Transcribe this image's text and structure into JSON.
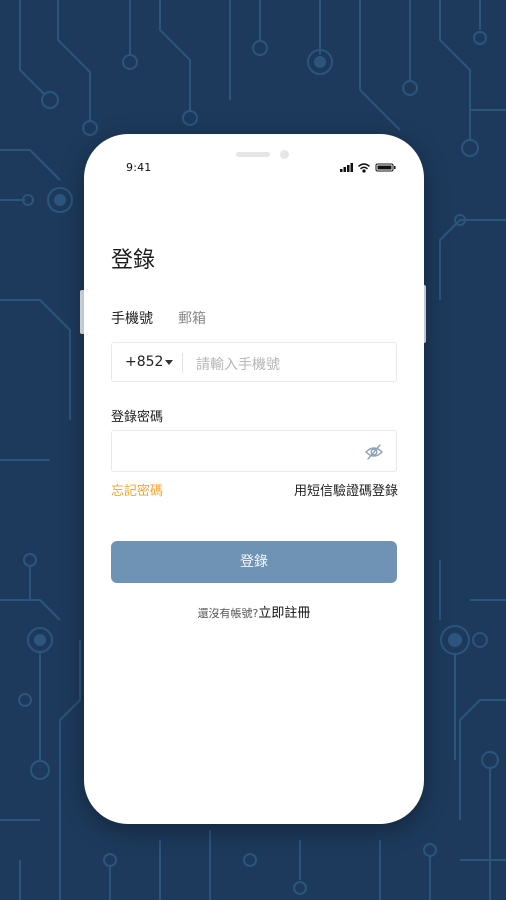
{
  "status_bar": {
    "time": "9:41"
  },
  "login": {
    "title": "登錄",
    "tabs": [
      {
        "label": "手機號"
      },
      {
        "label": "郵箱"
      }
    ],
    "country_code": "+852",
    "phone_placeholder": "請輸入手機號",
    "password_label": "登錄密碼",
    "forgot_password": "忘記密碼",
    "sms_login": "用短信驗證碼登錄",
    "submit": "登錄",
    "no_account": "還沒有帳號?",
    "register": "立即註冊"
  },
  "colors": {
    "background": "#1d3a5c",
    "accent_orange": "#f5a532",
    "button": "#6f93b5"
  },
  "icons": [
    "signal-icon",
    "wifi-icon",
    "battery-icon",
    "dropdown-caret-icon",
    "eye-hidden-icon"
  ]
}
